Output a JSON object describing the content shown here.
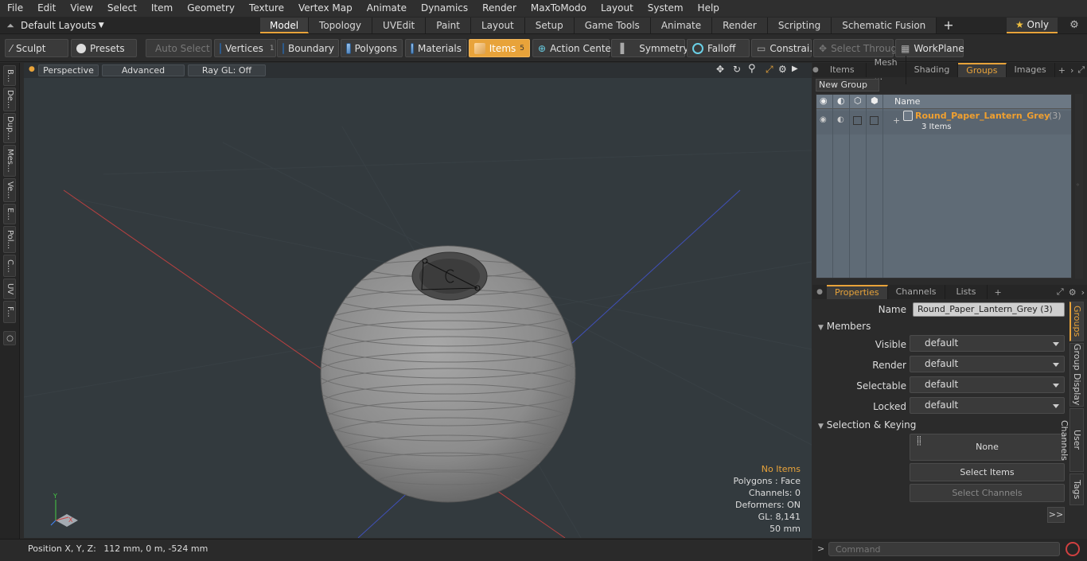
{
  "menu": [
    "File",
    "Edit",
    "View",
    "Select",
    "Item",
    "Geometry",
    "Texture",
    "Vertex Map",
    "Animate",
    "Dynamics",
    "Render",
    "MaxToModo",
    "Layout",
    "System",
    "Help"
  ],
  "layout_dropdown": "Default Layouts",
  "mode_tabs": [
    "Model",
    "Topology",
    "UVEdit",
    "Paint",
    "Layout",
    "Setup",
    "Game Tools",
    "Animate",
    "Render",
    "Scripting",
    "Schematic Fusion"
  ],
  "mode_active": "Model",
  "only_label": "Only",
  "toolbar": {
    "sculpt": "Sculpt",
    "presets": "Presets",
    "auto_select": "Auto Select",
    "vertices": "Vertices",
    "vertices_count": "1",
    "boundary": "Boundary",
    "polygons": "Polygons",
    "materials": "Materials",
    "items": "Items",
    "items_count": "5",
    "action_center": "Action Center",
    "symmetry": "Symmetry",
    "falloff": "Falloff",
    "constraints": "Constrai...",
    "select_through": "Select Through",
    "workplane": "WorkPlane"
  },
  "left_tabs": [
    "B...",
    "De...",
    "Dup...",
    "Mes...",
    "Ve...",
    "E...",
    "Pol...",
    "C...",
    "UV",
    "F..."
  ],
  "viewport": {
    "view_mode": "Perspective",
    "shading": "Advanced",
    "raygl": "Ray GL: Off",
    "info": {
      "selection": "No Items",
      "polygons": "Polygons : Face",
      "channels": "Channels: 0",
      "deformers": "Deformers: ON",
      "gl": "GL: 8,141",
      "scale": "50 mm"
    }
  },
  "status": {
    "label": "Position X, Y, Z:",
    "value": "112 mm, 0 m, -524 mm"
  },
  "right_top_tabs": [
    "Items",
    "Mesh ...",
    "Shading",
    "Groups",
    "Images"
  ],
  "right_top_active": "Groups",
  "groups": {
    "new_group": "New Group",
    "col_name": "Name",
    "group_name": "Round_Paper_Lantern_Grey",
    "group_count": "(3)",
    "group_sub": "3 Items"
  },
  "props_tabs": [
    "Properties",
    "Channels",
    "Lists"
  ],
  "props_active": "Properties",
  "props": {
    "name_label": "Name",
    "name_value": "Round_Paper_Lantern_Grey (3)",
    "members": "Members",
    "visible_label": "Visible",
    "visible": "default",
    "render_label": "Render",
    "render": "default",
    "selectable_label": "Selectable",
    "selectable": "default",
    "locked_label": "Locked",
    "locked": "default",
    "sel_keying": "Selection & Keying",
    "none": "None",
    "select_items": "Select Items",
    "select_channels": "Select Channels",
    "more": ">>"
  },
  "side_tabs": [
    "Groups",
    "Group Display",
    "User Channels",
    "Tags"
  ],
  "command_placeholder": "Command",
  "colors": {
    "accent": "#e8a33a",
    "viewport_bg": "#333a3e",
    "panel": "#2b2b2b",
    "list_bg": "#5f6b76"
  }
}
